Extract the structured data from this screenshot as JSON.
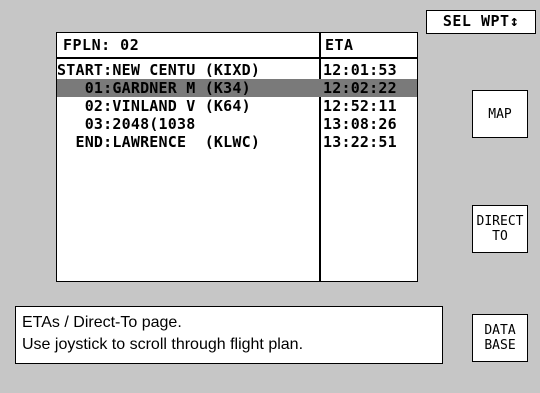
{
  "fpln": {
    "title": "FPLN: 02",
    "eta_header": "ETA",
    "rows": [
      {
        "name": "START:NEW CENTU (KIXD)",
        "eta": "12:01:53",
        "selected": false
      },
      {
        "name": "   01:GARDNER M (K34)",
        "eta": "12:02:22",
        "selected": true
      },
      {
        "name": "   02:VINLAND V (K64)",
        "eta": "12:52:11",
        "selected": false
      },
      {
        "name": "   03:2048(1038",
        "eta": "13:08:26",
        "selected": false
      },
      {
        "name": "  END:LAWRENCE  (KLWC)",
        "eta": "13:22:51",
        "selected": false
      }
    ]
  },
  "buttons": {
    "sel_wpt": "SEL WPT↕",
    "map": "MAP",
    "direct_line1": "DIRECT",
    "direct_line2": "TO",
    "database_line1": "DATA",
    "database_line2": "BASE"
  },
  "message": {
    "line1": "ETAs / Direct-To page.",
    "line2": "Use joystick to scroll through flight plan."
  }
}
